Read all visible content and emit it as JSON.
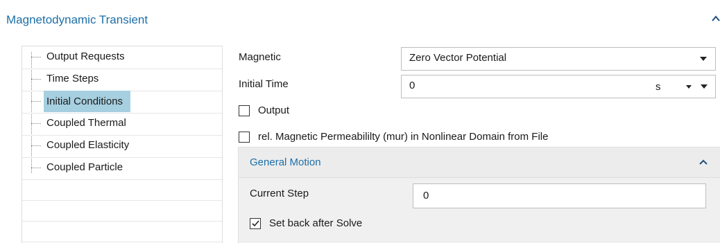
{
  "header": {
    "title": "Magnetodynamic Transient",
    "collapse_icon": "chevron-up-icon"
  },
  "tree": {
    "items": [
      {
        "label": "Output Requests",
        "selected": false
      },
      {
        "label": "Time Steps",
        "selected": false
      },
      {
        "label": "Initial Conditions",
        "selected": true
      },
      {
        "label": "Coupled Thermal",
        "selected": false
      },
      {
        "label": "Coupled Elasticity",
        "selected": false
      },
      {
        "label": "Coupled Particle",
        "selected": false
      }
    ],
    "selected_color": "#a6cfe0"
  },
  "form": {
    "magnetic": {
      "label": "Magnetic",
      "value": "Zero Vector Potential"
    },
    "initial_time": {
      "label": "Initial Time",
      "value": "0",
      "unit": "s"
    },
    "output": {
      "label": "Output",
      "checked": false
    },
    "mur": {
      "label": "rel. Magnetic Permeabililty (mur) in Nonlinear Domain from File",
      "checked": false
    }
  },
  "general_motion": {
    "title": "General Motion",
    "current_step": {
      "label": "Current Step",
      "value": "0"
    },
    "set_back": {
      "label": "Set back after Solve",
      "checked": true
    }
  },
  "colors": {
    "accent": "#1d6fa8"
  }
}
